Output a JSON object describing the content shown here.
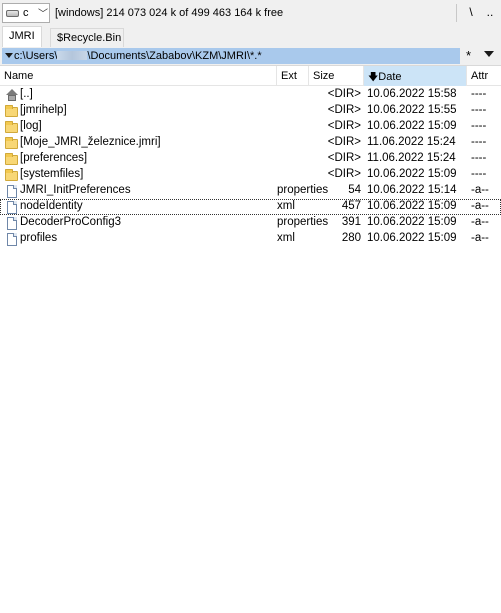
{
  "drive_bar": {
    "drive_letter": "c",
    "drive_icon": "hard-drive-icon",
    "volume_label": "[windows]",
    "free_space": "214 073 024 k of 499 463 164 k free",
    "root_button": "\\",
    "up_button": ".."
  },
  "tabs": [
    {
      "label": "JMRI",
      "active": true
    },
    {
      "label": "$Recycle.Bin",
      "active": false
    }
  ],
  "path_bar": {
    "path_prefix": "c:\\Users\\",
    "path_suffix": "\\Documents\\Zababov\\KZM\\JMRI\\*.*",
    "history_button": "*"
  },
  "columns": {
    "name": "Name",
    "ext": "Ext",
    "size": "Size",
    "date": "Date",
    "attr": "Attr",
    "sort_indicator": "down-arrow-icon"
  },
  "files": [
    {
      "icon": "up-dir-icon",
      "name": "[..]",
      "ext": "",
      "size": "<DIR>",
      "date": "10.06.2022 15:58",
      "attr": "----"
    },
    {
      "icon": "folder-icon",
      "name": "[jmrihelp]",
      "ext": "",
      "size": "<DIR>",
      "date": "10.06.2022 15:55",
      "attr": "----"
    },
    {
      "icon": "folder-icon",
      "name": "[log]",
      "ext": "",
      "size": "<DIR>",
      "date": "10.06.2022 15:09",
      "attr": "----"
    },
    {
      "icon": "folder-icon",
      "name": "[Moje_JMRI_železnice.jmri]",
      "ext": "",
      "size": "<DIR>",
      "date": "11.06.2022 15:24",
      "attr": "----"
    },
    {
      "icon": "folder-icon",
      "name": "[preferences]",
      "ext": "",
      "size": "<DIR>",
      "date": "11.06.2022 15:24",
      "attr": "----"
    },
    {
      "icon": "folder-icon",
      "name": "[systemfiles]",
      "ext": "",
      "size": "<DIR>",
      "date": "10.06.2022 15:09",
      "attr": "----"
    },
    {
      "icon": "file-icon",
      "name": "JMRI_InitPreferences",
      "ext": "properties",
      "size": "54",
      "date": "10.06.2022 15:14",
      "attr": "-a--"
    },
    {
      "icon": "file-icon",
      "name": "nodeIdentity",
      "ext": "xml",
      "size": "457",
      "date": "10.06.2022 15:09",
      "attr": "-a--"
    },
    {
      "icon": "file-icon",
      "name": "DecoderProConfig3",
      "ext": "properties",
      "size": "391",
      "date": "10.06.2022 15:09",
      "attr": "-a--"
    },
    {
      "icon": "file-icon",
      "name": "profiles",
      "ext": "xml",
      "size": "280",
      "date": "10.06.2022 15:09",
      "attr": "-a--"
    }
  ],
  "focused_row": 7,
  "colors": {
    "path_highlight": "#a9c9ec",
    "sorted_column": "#cce4f7",
    "folder": "#f8d775"
  }
}
